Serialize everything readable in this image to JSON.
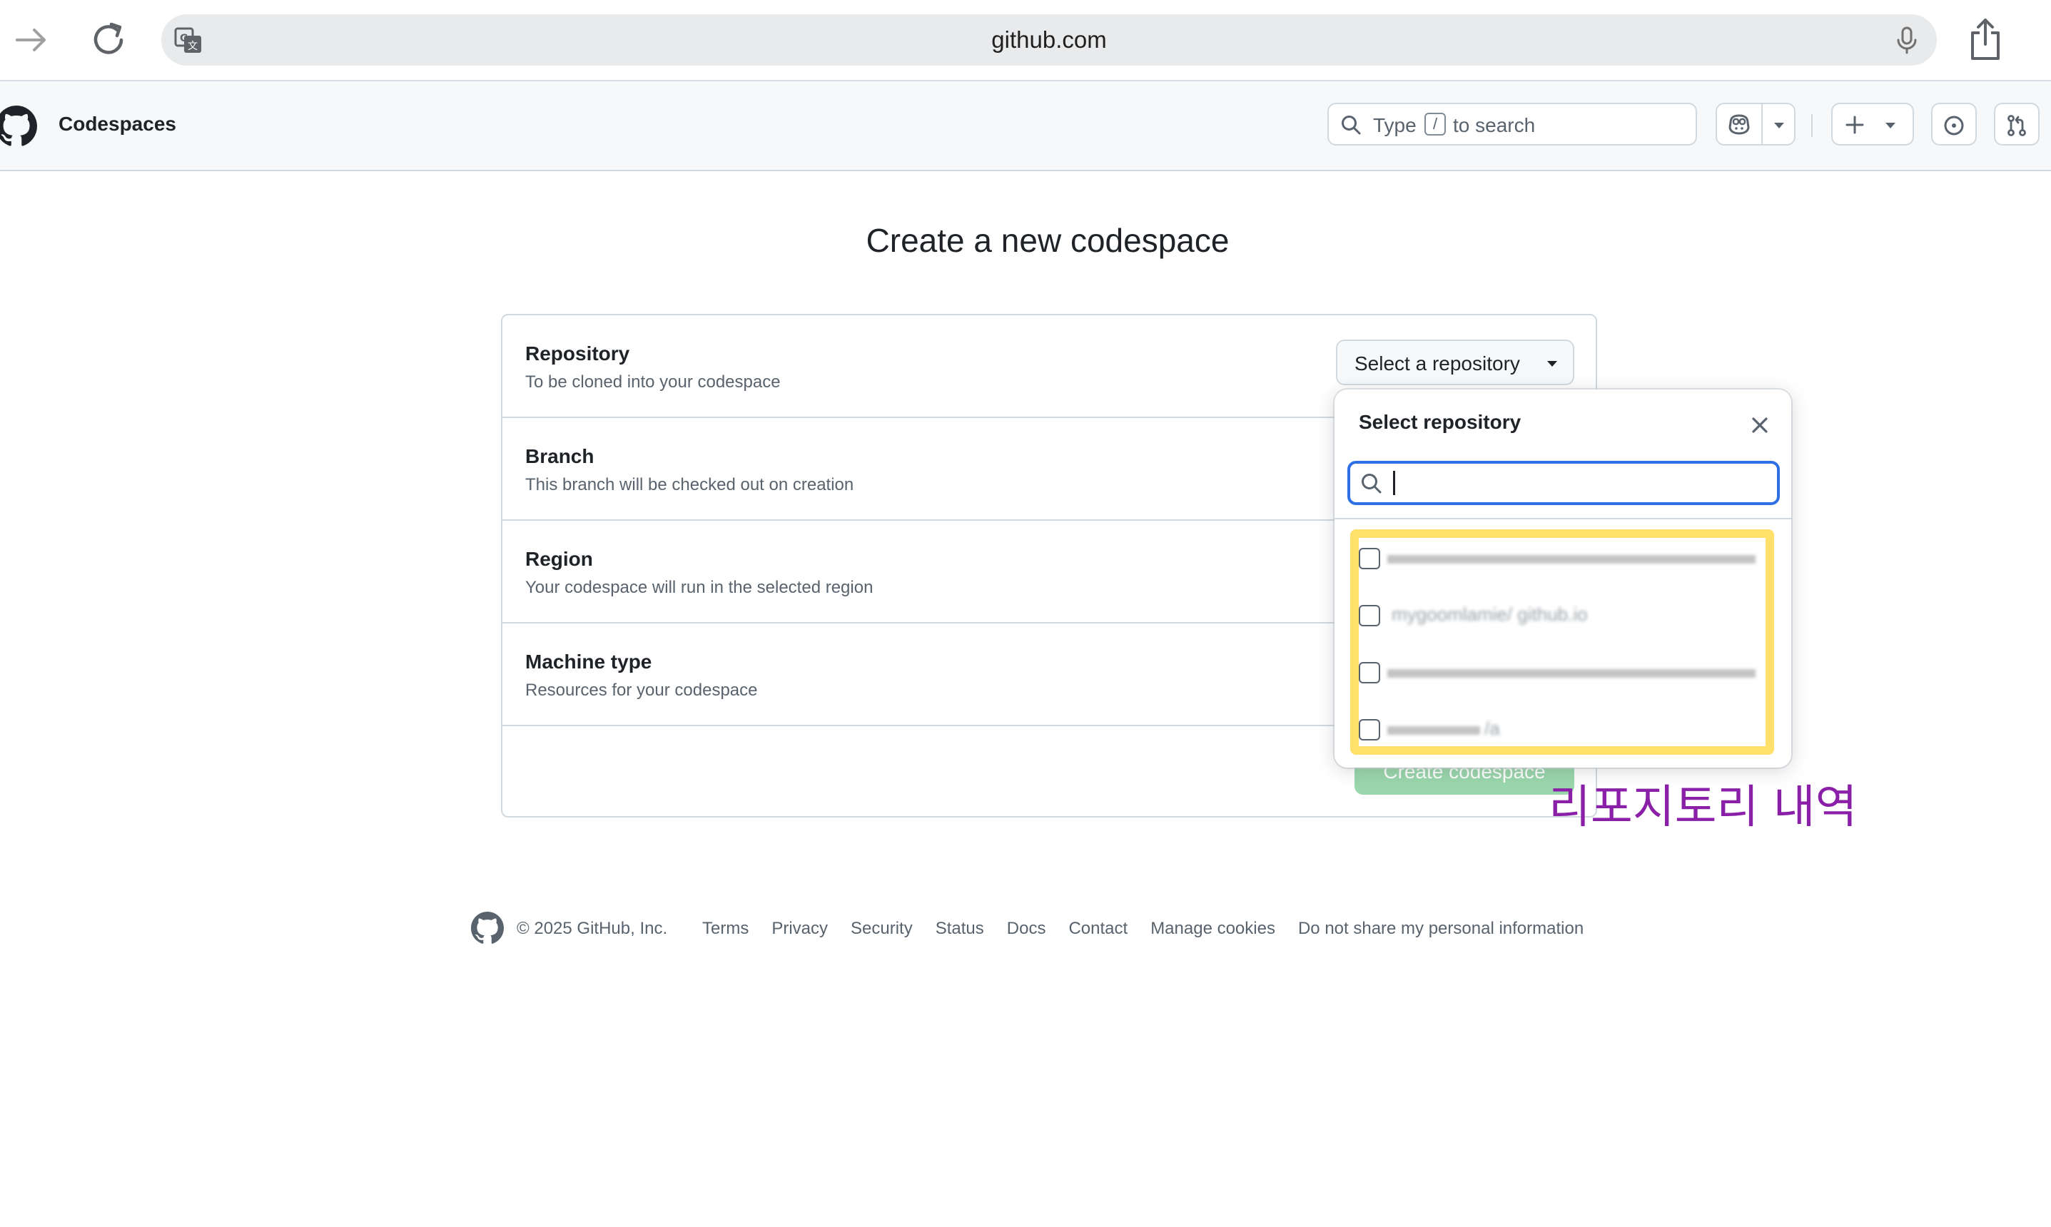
{
  "browser": {
    "url": "github.com"
  },
  "header": {
    "title": "Codespaces",
    "search_prefix": "Type",
    "search_key": "/",
    "search_suffix": "to search"
  },
  "main": {
    "title": "Create a new codespace",
    "rows": [
      {
        "title": "Repository",
        "description": "To be cloned into your codespace"
      },
      {
        "title": "Branch",
        "description": "This branch will be checked out on creation"
      },
      {
        "title": "Region",
        "description": "Your codespace will run in the selected region"
      },
      {
        "title": "Machine type",
        "description": "Resources for your codespace"
      }
    ],
    "repo_select_label": "Select a repository",
    "create_button": "Create codespace"
  },
  "dropdown": {
    "title": "Select repository",
    "search_value": "",
    "items": [
      {
        "label": ""
      },
      {
        "label": "mygoomlamie/ github.io"
      },
      {
        "label": ""
      },
      {
        "label": "/a"
      }
    ]
  },
  "annotation": "리포지토리 내역",
  "footer": {
    "copyright": "© 2025 GitHub, Inc.",
    "links": [
      "Terms",
      "Privacy",
      "Security",
      "Status",
      "Docs",
      "Contact",
      "Manage cookies",
      "Do not share my personal information"
    ]
  },
  "colors": {
    "highlight": "#ffe06a",
    "annotation": "#8a1fa8",
    "focus": "#2f6fe4",
    "create_button": "#9bd7ad"
  }
}
